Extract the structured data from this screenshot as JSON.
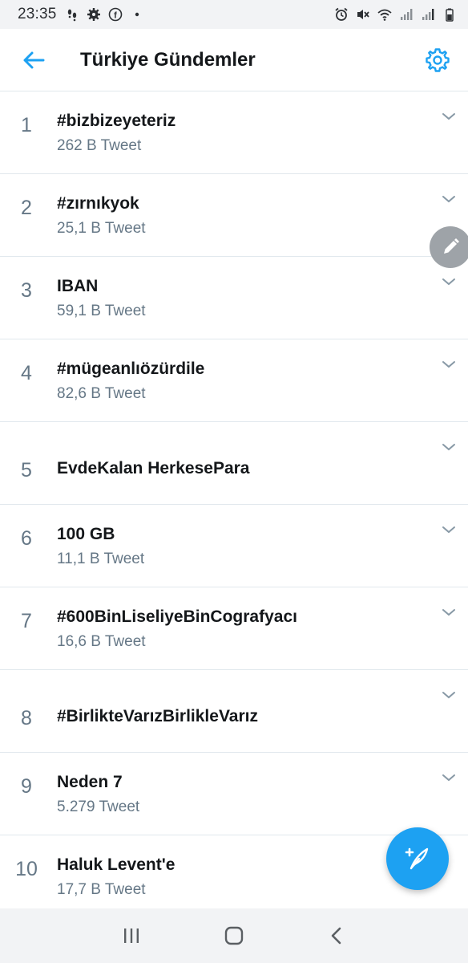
{
  "status_bar": {
    "time": "23:35",
    "left_icons": [
      "footprints-icon",
      "gear-icon",
      "facebook-icon",
      "dot-icon"
    ],
    "right_icons": [
      "alarm-icon",
      "mute-icon",
      "wifi-icon",
      "signal-icon",
      "signal-icon",
      "battery-icon"
    ]
  },
  "header": {
    "title": "Türkiye Gündemler",
    "back_icon": "arrow-left-icon",
    "settings_icon": "gear-icon"
  },
  "colors": {
    "accent": "#1da1f2",
    "text_primary": "#14171a",
    "text_secondary": "#657786",
    "divider": "#e1e8ed"
  },
  "trends": [
    {
      "rank": "1",
      "name": "#bizbizeyeteriz",
      "count": "262 B Tweet"
    },
    {
      "rank": "2",
      "name": "#zırnıkyok",
      "count": "25,1 B Tweet"
    },
    {
      "rank": "3",
      "name": "IBAN",
      "count": "59,1 B Tweet"
    },
    {
      "rank": "4",
      "name": "#mügeanlıözürdile",
      "count": "82,6 B Tweet"
    },
    {
      "rank": "5",
      "name": "EvdeKalan HerkesePara",
      "count": ""
    },
    {
      "rank": "6",
      "name": "100 GB",
      "count": "11,1 B Tweet"
    },
    {
      "rank": "7",
      "name": "#600BinLiseliyeBinCografyacı",
      "count": "16,6 B Tweet"
    },
    {
      "rank": "8",
      "name": "#BirlikteVarızBirlikleVarız",
      "count": ""
    },
    {
      "rank": "9",
      "name": "Neden 7",
      "count": "5.279 Tweet"
    },
    {
      "rank": "10",
      "name": "Haluk Levent'e",
      "count": "17,7 B Tweet"
    }
  ],
  "floating": {
    "edit_icon": "pencil-icon",
    "compose_icon": "compose-tweet-icon"
  },
  "navbar": {
    "items": [
      "recent-apps-icon",
      "home-icon",
      "back-icon"
    ]
  }
}
